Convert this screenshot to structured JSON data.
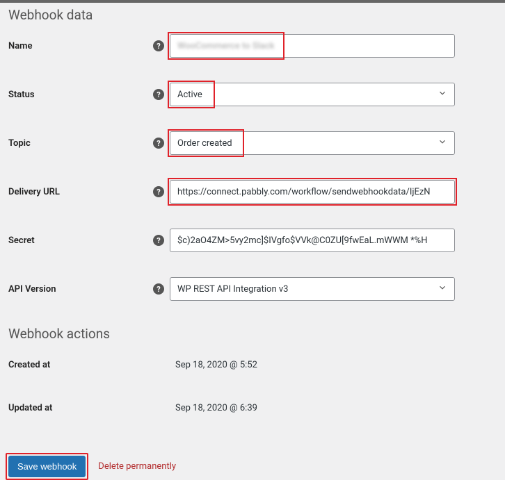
{
  "headings": {
    "webhook_data": "Webhook data",
    "webhook_actions": "Webhook actions"
  },
  "fields": {
    "name": {
      "label": "Name",
      "value": "WooCommerce to Slack"
    },
    "status": {
      "label": "Status",
      "value": "Active"
    },
    "topic": {
      "label": "Topic",
      "value": "Order created"
    },
    "delivery_url": {
      "label": "Delivery URL",
      "value": "https://connect.pabbly.com/workflow/sendwebhookdata/IjEzN"
    },
    "secret": {
      "label": "Secret",
      "value": "$c)2aO4ZM>5vy2mc]$IVgfo$VVk@C0ZU[9fwEaL.mWWM *%H"
    },
    "api_version": {
      "label": "API Version",
      "value": "WP REST API Integration v3"
    },
    "created_at": {
      "label": "Created at",
      "value": "Sep 18, 2020 @ 5:52"
    },
    "updated_at": {
      "label": "Updated at",
      "value": "Sep 18, 2020 @ 6:39"
    }
  },
  "actions": {
    "save": "Save webhook",
    "delete": "Delete permanently"
  },
  "colors": {
    "highlight_red": "#e0222a",
    "primary_blue": "#2271b1",
    "danger_text": "#b32d2e"
  }
}
